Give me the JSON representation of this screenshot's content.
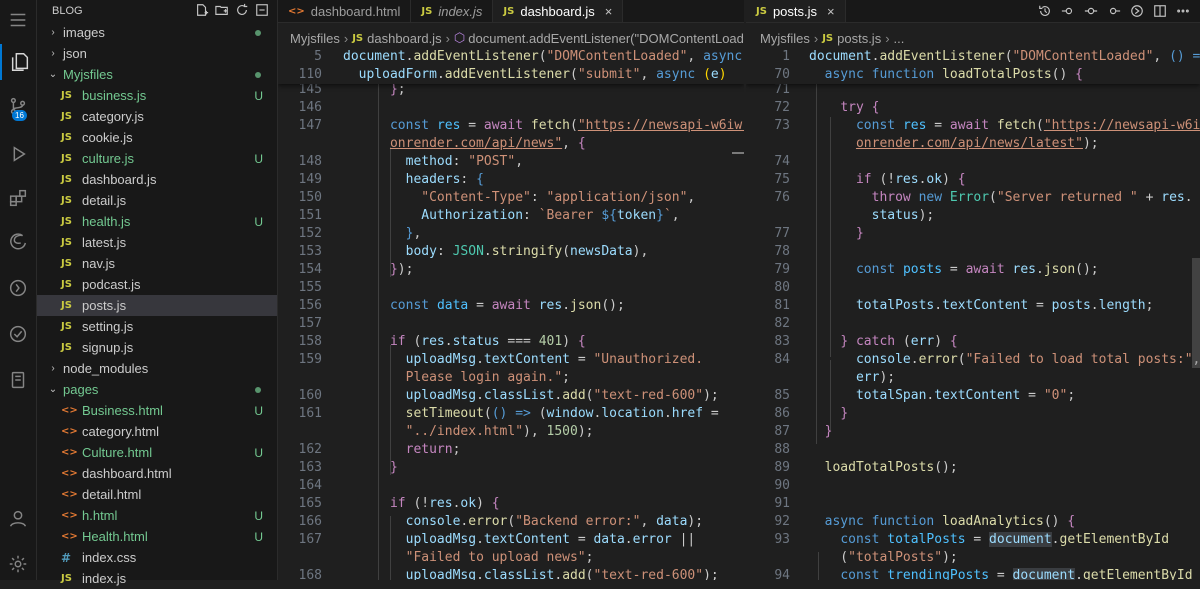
{
  "sidebar": {
    "title": "BLOG",
    "items": [
      {
        "label": "images",
        "type": "folder",
        "chev": ">",
        "indent": 1,
        "status": "dot"
      },
      {
        "label": "json",
        "type": "folder",
        "chev": ">",
        "indent": 1
      },
      {
        "label": "Myjsfiles",
        "type": "folder",
        "chev": "v",
        "indent": 1,
        "untracked": true,
        "status": "dot"
      },
      {
        "label": "business.js",
        "type": "js",
        "indent": 2,
        "untracked": true,
        "status": "U"
      },
      {
        "label": "category.js",
        "type": "js",
        "indent": 2
      },
      {
        "label": "cookie.js",
        "type": "js",
        "indent": 2
      },
      {
        "label": "culture.js",
        "type": "js",
        "indent": 2,
        "untracked": true,
        "status": "U"
      },
      {
        "label": "dashboard.js",
        "type": "js",
        "indent": 2
      },
      {
        "label": "detail.js",
        "type": "js",
        "indent": 2
      },
      {
        "label": "health.js",
        "type": "js",
        "indent": 2,
        "untracked": true,
        "status": "U"
      },
      {
        "label": "latest.js",
        "type": "js",
        "indent": 2
      },
      {
        "label": "nav.js",
        "type": "js",
        "indent": 2
      },
      {
        "label": "podcast.js",
        "type": "js",
        "indent": 2
      },
      {
        "label": "posts.js",
        "type": "js",
        "indent": 2,
        "selected": true
      },
      {
        "label": "setting.js",
        "type": "js",
        "indent": 2
      },
      {
        "label": "signup.js",
        "type": "js",
        "indent": 2
      },
      {
        "label": "node_modules",
        "type": "folder",
        "chev": ">",
        "indent": 1
      },
      {
        "label": "pages",
        "type": "folder",
        "chev": "v",
        "indent": 1,
        "untracked": true,
        "status": "dot"
      },
      {
        "label": "Business.html",
        "type": "html",
        "indent": 2,
        "untracked": true,
        "status": "U"
      },
      {
        "label": "category.html",
        "type": "html",
        "indent": 2
      },
      {
        "label": "Culture.html",
        "type": "html",
        "indent": 2,
        "untracked": true,
        "status": "U"
      },
      {
        "label": "dashboard.html",
        "type": "html",
        "indent": 2
      },
      {
        "label": "detail.html",
        "type": "html",
        "indent": 2
      },
      {
        "label": "h.html",
        "type": "html",
        "indent": 2,
        "untracked": true,
        "status": "U"
      },
      {
        "label": "Health.html",
        "type": "html",
        "indent": 2,
        "untracked": true,
        "status": "U"
      },
      {
        "label": "index.css",
        "type": "css",
        "indent": 2
      },
      {
        "label": "index.js",
        "type": "js",
        "indent": 2
      }
    ]
  },
  "activity": {
    "badge": "16"
  },
  "left_pane": {
    "tabs": [
      {
        "label": "dashboard.html",
        "type": "html"
      },
      {
        "label": "index.js",
        "type": "js",
        "italic": true
      },
      {
        "label": "dashboard.js",
        "type": "js",
        "active": true,
        "close": "×"
      }
    ],
    "breadcrumb": {
      "folder": "Myjsfiles",
      "file": "dashboard.js",
      "symbol": "document.addEventListener(\"DOMContentLoaded\""
    }
  },
  "right_pane": {
    "tabs": [
      {
        "label": "posts.js",
        "type": "js",
        "active": true,
        "close": "×"
      }
    ],
    "breadcrumb": {
      "folder": "Myjsfiles",
      "file": "posts.js",
      "symbol": "..."
    }
  }
}
